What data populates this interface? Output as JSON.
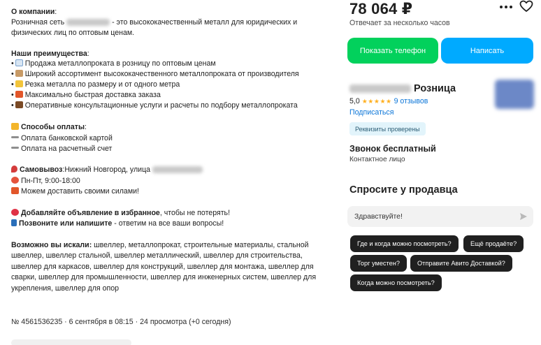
{
  "description": {
    "about_title": "О компании",
    "about_prefix": "Розничная сеть",
    "about_suffix": "- это высококачественный металл для юридических и",
    "about_line2": "физических лиц по оптовым ценам.",
    "advantages_title": "Наши преимущества",
    "advantages": [
      "Продажа металлопроката в розницу по оптовым ценам",
      "Широкий ассортимент высококачественного металлопроката от производителя",
      "Резка металла по размеру и от одного метра",
      "Максимально быстрая доставка заказа",
      "Оперативные консультационные услуги и расчеты по подбору металлопроката"
    ],
    "payment_title": "Способы оплаты",
    "payment": [
      "Оплата банковской картой",
      "Оплата на расчетный счет"
    ],
    "pickup_label": "Самовывоз",
    "pickup_text": "Нижний Новгород, улица",
    "hours": "Пн-Пт, 9:00-18:00",
    "delivery": "Можем доставить своими силами!",
    "favorite_bold": "Добавляйте объявление в избранное",
    "favorite_rest": ", чтобы не потерять!",
    "call_bold": "Позвоните или напишите",
    "call_rest": " - ответим на все ваши вопросы!",
    "search_title": "Возможно вы искали",
    "search_text": "швеллер, металлопрокат, строительные материалы, стальной швеллер, швеллер стальной, швеллер металлический, швеллер для строительства, швеллер для каркасов, швеллер для конструкций, швеллер для монтажа, швеллер для сварки, швеллер для промышленности, швеллер для инженерных систем, швеллер для укрепления, швеллер для опор"
  },
  "meta": "№ 4561536235 · 6 сентября в 08:15 · 24 просмотра (+0 сегодня)",
  "sidebar": {
    "price": "78 064 ₽",
    "reply_time": "Отвечает за несколько часов",
    "show_phone": "Показать телефон",
    "write": "Написать",
    "seller_name": "Розница",
    "rating": "5,0",
    "stars": "★★★★★",
    "reviews": "9 отзывов",
    "subscribed": "Подписаться",
    "verified_badge": "Реквизиты проверены",
    "call_free": "Звонок бесплатный",
    "contact_person": "Контактное лицо",
    "ask_title": "Спросите у продавца",
    "message_value": "Здравствуйте!",
    "quick_questions": [
      "Где и когда можно посмотреть?",
      "Ещё продаёте?",
      "Торг уместен?",
      "Отправите Авито Доставкой?",
      "Когда можно посмотреть?"
    ]
  },
  "colors": {
    "green": "#02d15c",
    "blue": "#00aaff",
    "link": "#0a75d8",
    "star": "#ffb021",
    "chip": "#202020",
    "badge_bg": "#e2f4fb"
  },
  "icons": [
    "more-icon",
    "heart-icon",
    "send-icon"
  ]
}
